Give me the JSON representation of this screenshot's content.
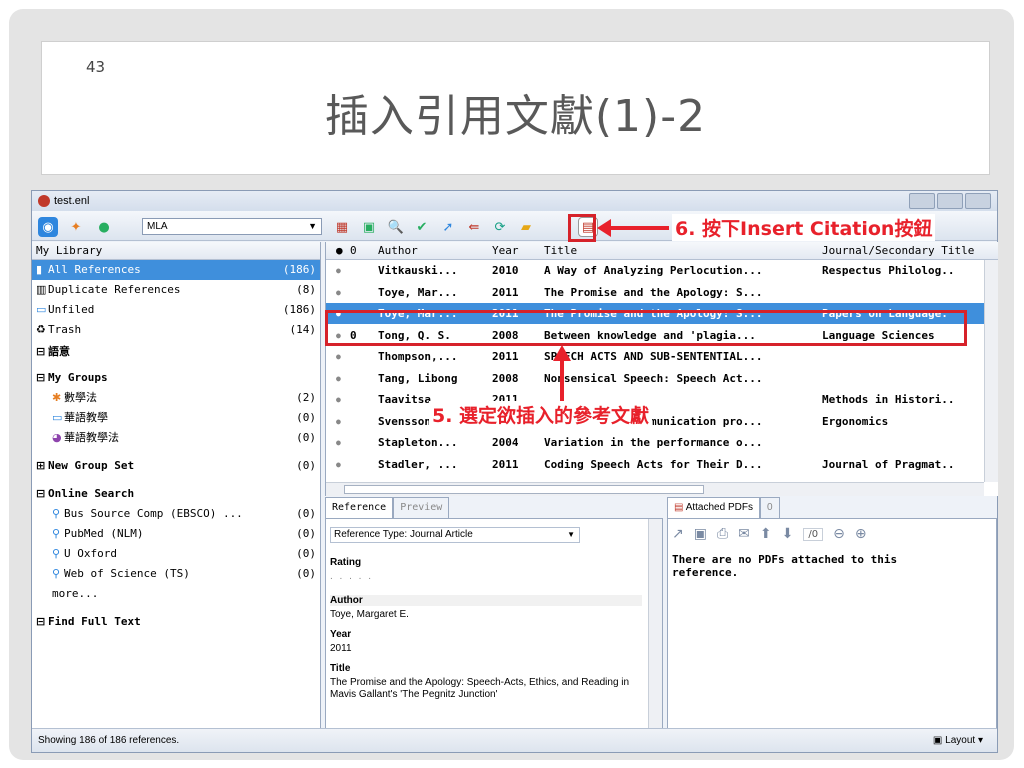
{
  "slide": {
    "number": "43",
    "title": "插入引用文獻(1)-2"
  },
  "window": {
    "title": "test.enl"
  },
  "toolbar": {
    "style_value": "MLA"
  },
  "library": {
    "header": "My Library",
    "items": [
      {
        "label": "All References",
        "count": "(186)",
        "icon": "folder-icon"
      },
      {
        "label": "Duplicate References",
        "count": "(8)",
        "icon": "duplicate-icon"
      },
      {
        "label": "Unfiled",
        "count": "(186)",
        "icon": "folder-icon"
      },
      {
        "label": "Trash",
        "count": "(14)",
        "icon": "trash-icon"
      }
    ],
    "sections": [
      {
        "label": "語意"
      },
      {
        "label": "My Groups"
      }
    ],
    "groups": [
      {
        "label": "數學法",
        "count": "(2)"
      },
      {
        "label": "華語教學",
        "count": "(0)"
      },
      {
        "label": "華語教學法",
        "count": "(0)"
      }
    ],
    "new_group_set": {
      "label": "New Group Set",
      "count": "(0)"
    },
    "online_search": {
      "label": "Online Search",
      "items": [
        {
          "label": "Bus Source Comp (EBSCO) ...",
          "count": "(0)"
        },
        {
          "label": "PubMed (NLM)",
          "count": "(0)"
        },
        {
          "label": "U Oxford",
          "count": "(0)"
        },
        {
          "label": "Web of Science (TS)",
          "count": "(0)"
        }
      ],
      "more": "more..."
    },
    "find_full_text": "Find Full Text"
  },
  "ref_list": {
    "columns": {
      "author": "Author",
      "year": "Year",
      "title": "Title",
      "journal": "Journal/Secondary Title"
    },
    "rows": [
      {
        "author": "Vitkauski...",
        "year": "2010",
        "title": "A Way of Analyzing Perlocution...",
        "journal": "Respectus Philolog..",
        "clip": ""
      },
      {
        "author": "Toye, Mar...",
        "year": "2011",
        "title": "The Promise and the Apology: S...",
        "journal": "",
        "clip": ""
      },
      {
        "author": "Toye, Mar...",
        "year": "2011",
        "title": "The Promise and the Apology: S...",
        "journal": "Papers on Language.",
        "clip": ""
      },
      {
        "author": "Tong, Q. S.",
        "year": "2008",
        "title": "Between knowledge and 'plagia...",
        "journal": "Language Sciences",
        "clip": "0"
      },
      {
        "author": "Thompson,...",
        "year": "2011",
        "title": "SPEECH ACTS AND SUB-SENTENTIAL...",
        "journal": "",
        "clip": ""
      },
      {
        "author": "Tang, Libong",
        "year": "2008",
        "title": "Nonsensical Speech: Speech Act...",
        "journal": "",
        "clip": ""
      },
      {
        "author": "Taavitsa...",
        "year": "2011",
        "title": "...",
        "journal": "Methods in Histori..",
        "clip": ""
      },
      {
        "author": "Svensson,...",
        "year": "2008",
        "title": "Speech acts, communication pro...",
        "journal": "Ergonomics",
        "clip": ""
      },
      {
        "author": "Stapleton...",
        "year": "2004",
        "title": "Variation in the performance o...",
        "journal": "",
        "clip": ""
      },
      {
        "author": "Stadler, ...",
        "year": "2011",
        "title": "Coding Speech Acts for Their D...",
        "journal": "Journal of Pragmat..",
        "clip": ""
      }
    ],
    "selected_index": 2
  },
  "reference_panel": {
    "tabs": [
      "Reference",
      "Preview"
    ],
    "ref_type_label": "Reference Type: Journal Article",
    "rating_label": "Rating",
    "rating_dots": ". . . . .",
    "author_label": "Author",
    "author_value": "Toye, Margaret E.",
    "year_label": "Year",
    "year_value": "2011",
    "title_label": "Title",
    "title_value": "The Promise and the Apology: Speech-Acts, Ethics, and Reading in Mavis Gallant's 'The Pegnitz Junction'"
  },
  "pdf_panel": {
    "tab": "Attached PDFs",
    "page_counter": "/0",
    "message": "There are no PDFs attached to this\nreference."
  },
  "status": {
    "text": "Showing 186 of 186 references.",
    "layout": "Layout"
  },
  "annotations": {
    "step6": "6. 按下Insert Citation按鈕",
    "step5": "5. 選定欲插入的參考文獻"
  }
}
